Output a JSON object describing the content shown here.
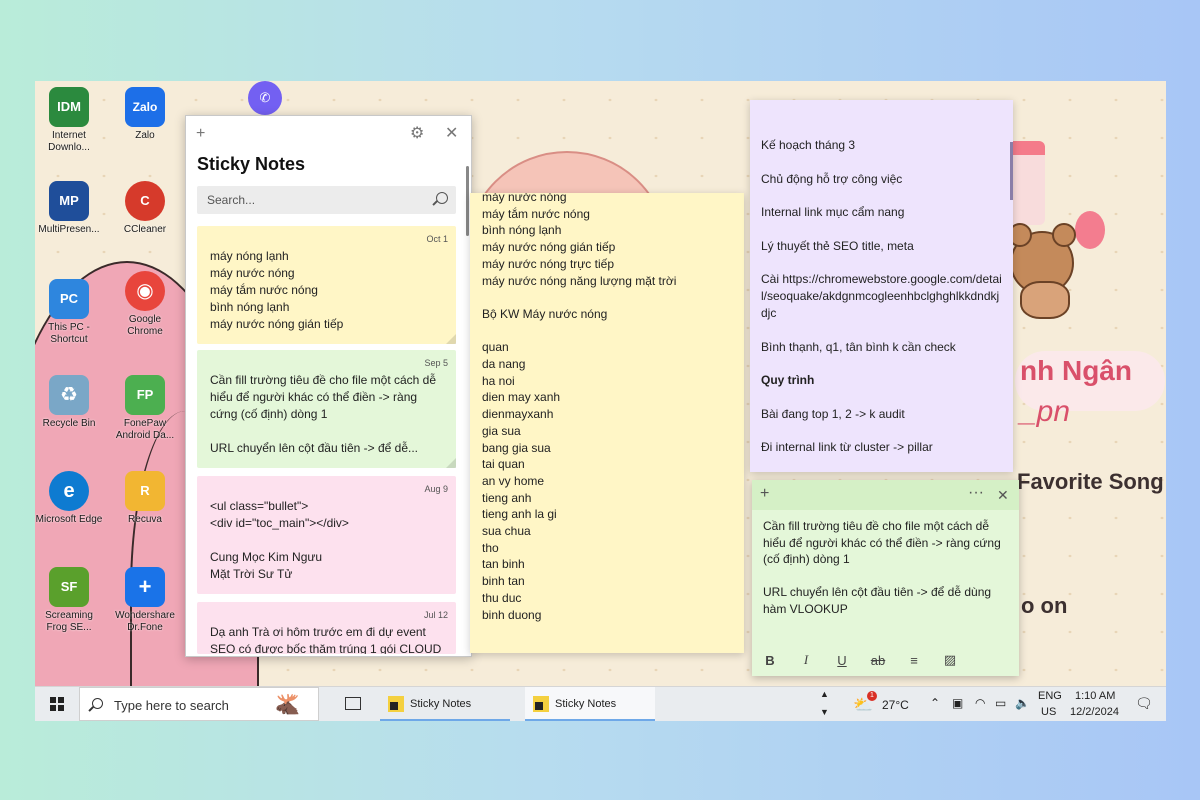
{
  "desktop_icons": [
    {
      "label": "Internet Downlo...",
      "color": "#2b8a3e",
      "glyph": "IDM"
    },
    {
      "label": "Zalo",
      "color": "#1d6fe8",
      "glyph": "Zalo"
    },
    {
      "label": "",
      "color": "#7360f2",
      "glyph": "✆"
    },
    {
      "label": "MultiPresen...",
      "color": "#1f4e9a",
      "glyph": "MP"
    },
    {
      "label": "CCleaner",
      "color": "#d63a2b",
      "glyph": "C"
    },
    {
      "label": "This PC - Shortcut",
      "color": "#2e86de",
      "glyph": "PC"
    },
    {
      "label": "Google Chrome",
      "color": "#e8453c",
      "glyph": "◉"
    },
    {
      "label": "Recycle Bin",
      "color": "#7aa7c7",
      "glyph": "♻"
    },
    {
      "label": "FonePaw Android Da...",
      "color": "#4caf50",
      "glyph": "FP"
    },
    {
      "label": "Microsoft Edge",
      "color": "#0e7bd1",
      "glyph": "e"
    },
    {
      "label": "Recuva",
      "color": "#f2b632",
      "glyph": "R"
    },
    {
      "label": "Screaming Frog SE...",
      "color": "#5aa02c",
      "glyph": "SF"
    },
    {
      "label": "Wondershare Dr.Fone",
      "color": "#1a73e8",
      "glyph": "+"
    }
  ],
  "list_window": {
    "title": "Sticky Notes",
    "search_placeholder": "Search...",
    "notes": [
      {
        "date": "Oct 1",
        "color": "#fff6c6",
        "text": "máy nóng lạnh\nmáy nước nóng\nmáy tắm nước nóng\nbình nóng lạnh\nmáy nước nóng gián tiếp"
      },
      {
        "date": "Sep 5",
        "color": "#e4f7d9",
        "text": "Cần fill trường tiêu đề cho file một cách dễ hiểu để người khác có thể điền -> ràng cứng (cố định) dòng 1\n\nURL chuyển lên cột đầu tiên -> để dễ..."
      },
      {
        "date": "Aug 9",
        "color": "#fde1ee",
        "text": "<ul class=\"bullet\">\n<div id=\"toc_main\"></div>\n\nCung Mọc Kim Ngưu\nMặt Trời Sư Tử"
      },
      {
        "date": "Jul 12",
        "color": "#fde1ee",
        "text": "Dạ anh Trà ơi hôm trước em đi dự event SEO có được bốc thăm trúng 1 gói CLOUD"
      }
    ]
  },
  "yellow_note": {
    "text": "máy nước nóng\nmáy tắm nước nóng\nbình nóng lạnh\nmáy nước nóng gián tiếp\nmáy nước nóng trực tiếp\nmáy nước nóng năng lượng mặt trời\n\nBộ KW Máy nước nóng\n\nquan\nda nang\nha noi\ndien may xanh\ndienmayxanh\ngia sua\nbang gia sua\ntai quan\nan vy home\ntieng anh\ntieng anh la gi\nsua chua\ntho\ntan binh\nbinh tan\nthu duc\nbinh duong"
  },
  "purple_note": {
    "lines": [
      {
        "text": "Kế hoạch tháng 3",
        "bold": false
      },
      {
        "text": "Chủ động hỗ trợ công việc",
        "bold": false
      },
      {
        "text": "Internal link mục cẩm nang",
        "bold": false
      },
      {
        "text": "Lý thuyết thẻ SEO title, meta",
        "bold": false
      },
      {
        "text": "Cài https://chromewebstore.google.com/detail/seoquake/akdgnmcogleenhbclghghlkkdndkjdjc",
        "bold": false
      },
      {
        "text": "Bình thạnh, q1, tân bình k cần check",
        "bold": false
      },
      {
        "text": "Quy trình",
        "bold": true
      },
      {
        "text": "Bài đang top 1, 2 -> k audit",
        "bold": false
      },
      {
        "text": "Đi internal link từ cluster -> pillar",
        "bold": false
      }
    ]
  },
  "green_note": {
    "text": "Cần fill trường tiêu đề cho file một cách dễ hiểu để người khác có thể điền -> ràng cứng (cố định) dòng 1\n\nURL chuyển lên cột đầu tiên -> để dễ dùng hàm VLOOKUP",
    "toolbar": [
      "B",
      "I",
      "U",
      "ab",
      "≡",
      "▨"
    ]
  },
  "wallpaper": {
    "name_fragment": "nh Ngân",
    "handle_fragment": "_pn",
    "song_text": "Favorite Song",
    "on_text": "o on"
  },
  "taskbar": {
    "search_placeholder": "Type here to search",
    "apps": [
      "Sticky Notes",
      "Sticky Notes"
    ],
    "weather": "27°C",
    "weather_badge": "1",
    "lang": "ENG",
    "region": "US",
    "time": "1:10 AM",
    "date": "12/2/2024"
  }
}
